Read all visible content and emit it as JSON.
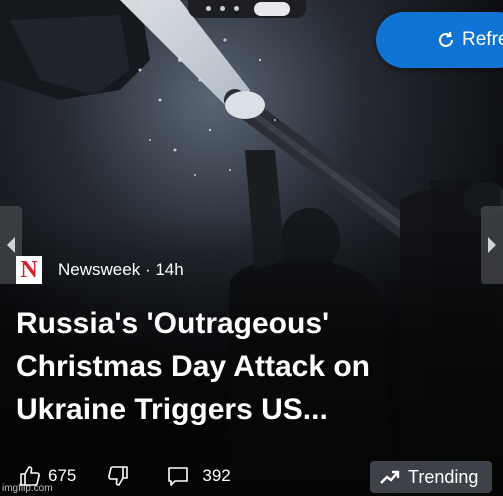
{
  "refresh": {
    "label": "Refre",
    "icon": "refresh-icon"
  },
  "article": {
    "source": "Newsweek",
    "source_logo_letter": "N",
    "age": "14h",
    "headline": "Russia's 'Outrageous' Christmas Day Attack on Ukraine Triggers US..."
  },
  "actions": {
    "likes": "675",
    "comments": "392",
    "trending_label": "Trending"
  },
  "watermark": "imgflip.com",
  "colors": {
    "refresh_bg": "#0f74d6",
    "logo_red": "#d6202b",
    "trending_bg": "#3f4148"
  }
}
